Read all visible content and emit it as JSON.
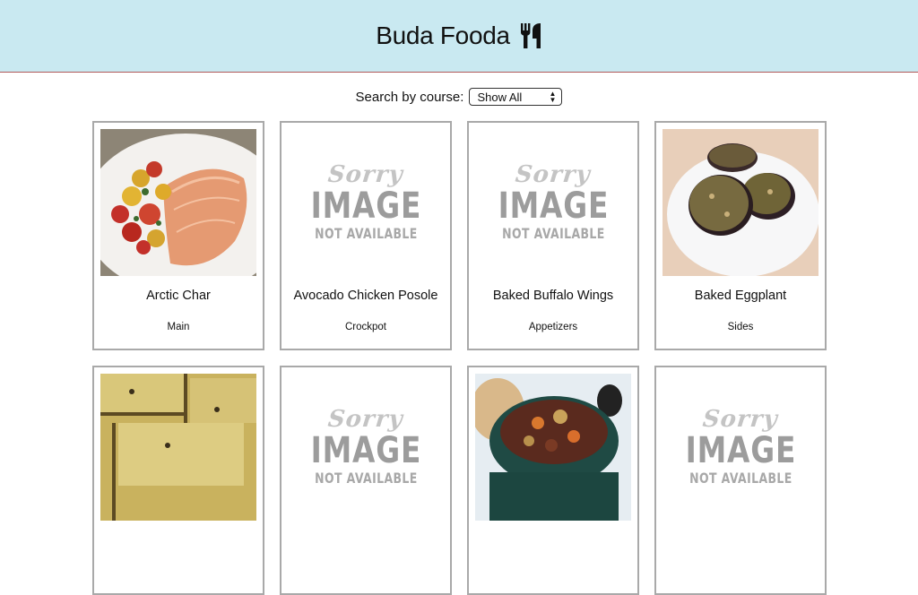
{
  "header": {
    "title": "Buda Fooda",
    "logo_icon": "fork-knife-icon",
    "background_color": "#c9e9f1",
    "border_color": "#b05a5a"
  },
  "search": {
    "label": "Search by course:",
    "selected": "Show All",
    "icon": "select-arrows-icon"
  },
  "placeholder_image": {
    "line1": "Sorry",
    "line2": "IMAGE",
    "line3": "NOT AVAILABLE"
  },
  "recipes": [
    {
      "name": "Arctic Char",
      "course": "Main",
      "image": "arctic-char-photo"
    },
    {
      "name": "Avocado Chicken Posole",
      "course": "Crockpot",
      "image": "image-not-available"
    },
    {
      "name": "Baked Buffalo Wings",
      "course": "Appetizers",
      "image": "image-not-available"
    },
    {
      "name": "Baked Eggplant",
      "course": "Sides",
      "image": "baked-eggplant-photo"
    },
    {
      "name": "",
      "course": "",
      "image": "cornbread-photo"
    },
    {
      "name": "",
      "course": "",
      "image": "image-not-available"
    },
    {
      "name": "",
      "course": "",
      "image": "stew-photo"
    },
    {
      "name": "",
      "course": "",
      "image": "image-not-available"
    }
  ]
}
